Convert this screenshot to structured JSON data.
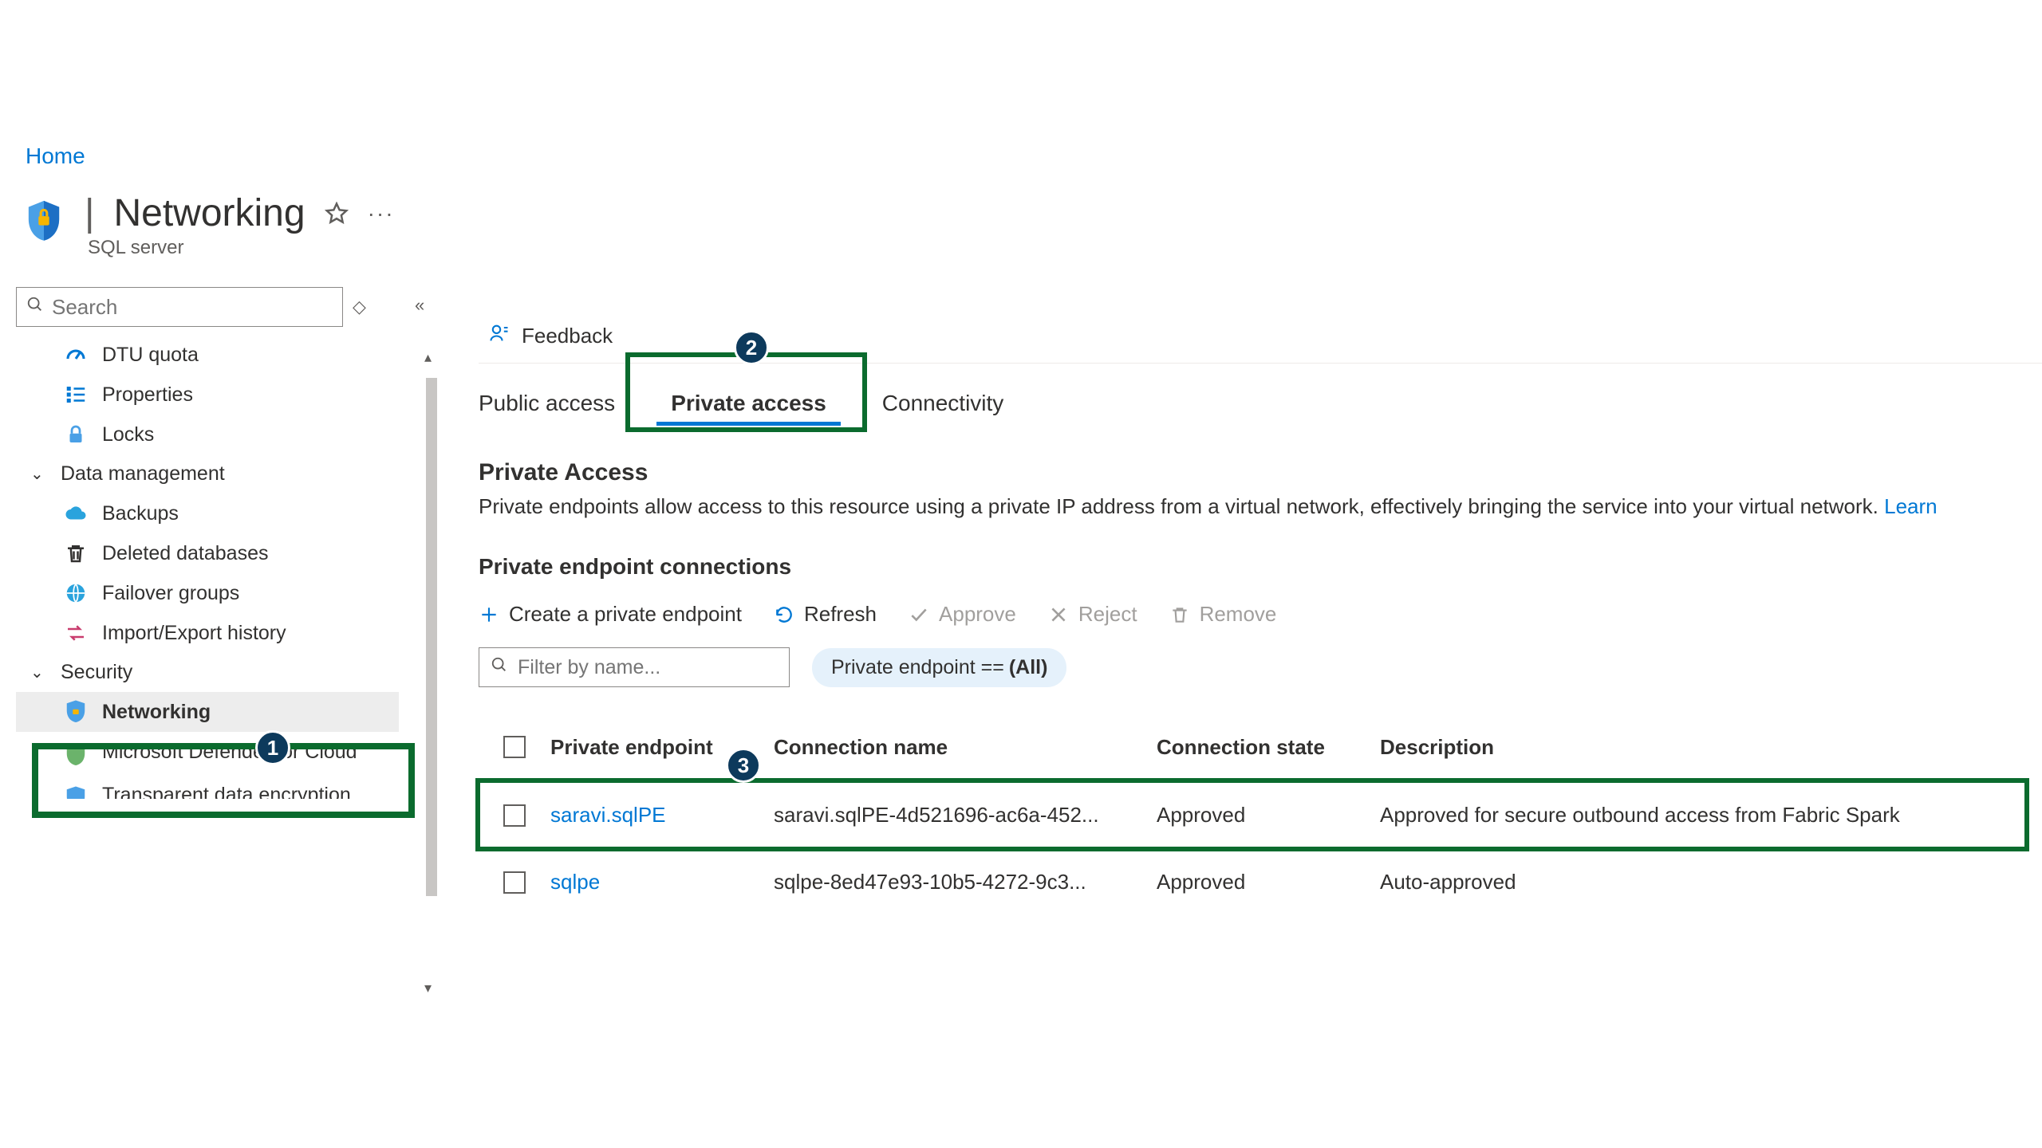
{
  "breadcrumb": {
    "home": "Home"
  },
  "header": {
    "title_prefix": "|",
    "title": "Networking",
    "resource_type": "SQL server",
    "callouts": {
      "one": "1",
      "two": "2",
      "three": "3"
    }
  },
  "sidebar": {
    "search_placeholder": "Search",
    "items_top": [
      {
        "icon": "dtu",
        "label": "DTU quota"
      },
      {
        "icon": "properties",
        "label": "Properties"
      },
      {
        "icon": "locks",
        "label": "Locks"
      }
    ],
    "group_data_mgmt": "Data management",
    "items_data_mgmt": [
      {
        "icon": "backups",
        "label": "Backups"
      },
      {
        "icon": "trash",
        "label": "Deleted databases"
      },
      {
        "icon": "globe",
        "label": "Failover groups"
      },
      {
        "icon": "ie",
        "label": "Import/Export history"
      }
    ],
    "group_security": "Security",
    "items_security": [
      {
        "icon": "shield",
        "label": "Networking"
      },
      {
        "icon": "defender",
        "label": "Microsoft Defender for Cloud"
      },
      {
        "icon": "shield2",
        "label": "Transparent data encryption"
      }
    ]
  },
  "toolbar_top": {
    "feedback": "Feedback"
  },
  "tabs": {
    "public": "Public access",
    "private": "Private access",
    "connectivity": "Connectivity"
  },
  "section": {
    "title": "Private Access",
    "desc": "Private endpoints allow access to this resource using a private IP address from a virtual network, effectively bringing the service into your virtual network.",
    "learn": "Learn",
    "connections_title": "Private endpoint connections"
  },
  "actions": {
    "create": "Create a private endpoint",
    "refresh": "Refresh",
    "approve": "Approve",
    "reject": "Reject",
    "remove": "Remove"
  },
  "filter": {
    "placeholder": "Filter by name...",
    "pill_key": "Private endpoint ==",
    "pill_val": "(All)"
  },
  "table": {
    "headers": {
      "pe": "Private endpoint",
      "conn": "Connection name",
      "state": "Connection state",
      "desc": "Description"
    },
    "rows": [
      {
        "pe": "saravi.sqlPE",
        "conn": "saravi.sqlPE-4d521696-ac6a-452...",
        "state": "Approved",
        "desc": "Approved for secure outbound access from Fabric Spark"
      },
      {
        "pe": "sqlpe",
        "conn": "sqlpe-8ed47e93-10b5-4272-9c3...",
        "state": "Approved",
        "desc": "Auto-approved"
      }
    ]
  }
}
